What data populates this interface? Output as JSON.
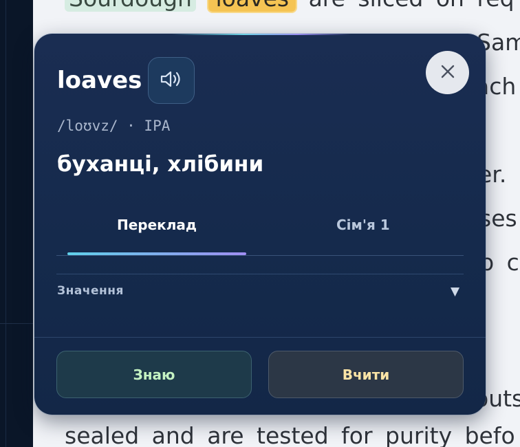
{
  "reader": {
    "lines": [
      {
        "highlight_green": "Sourdough",
        "highlight_yellow": "loaves",
        "rest": "are sliced on req"
      },
      {
        "text": "Sam"
      },
      {
        "text": "ach"
      },
      {
        "text": "er."
      },
      {
        "text": "ses"
      },
      {
        "text": "o c"
      },
      {
        "text": "outsi"
      },
      {
        "text": "sealed and are tested for purity befo"
      }
    ]
  },
  "popover": {
    "word": "loaves",
    "speak_icon": "speaker-icon",
    "close_icon": "close-icon",
    "pronunciation": "/loʊvz/ · IPA",
    "translation": "буханці, хлібини",
    "tabs": [
      {
        "label": "Переклад",
        "active": true
      },
      {
        "label": "Сім'я 1",
        "active": false
      }
    ],
    "meaning_section": {
      "label": "Значення",
      "icon": "caret-down-icon"
    },
    "actions": {
      "know_label": "Знаю",
      "learn_label": "Вчити"
    }
  },
  "colors": {
    "card_bg": "#172b4f",
    "tab_indicator_start": "#5fd0ea",
    "tab_indicator_end": "#a08ef2",
    "highlight_yellow": "#f5c453",
    "highlight_green": "#d6ece2",
    "know_text": "#c4f2c2",
    "learn_text": "#fbe4a6"
  }
}
